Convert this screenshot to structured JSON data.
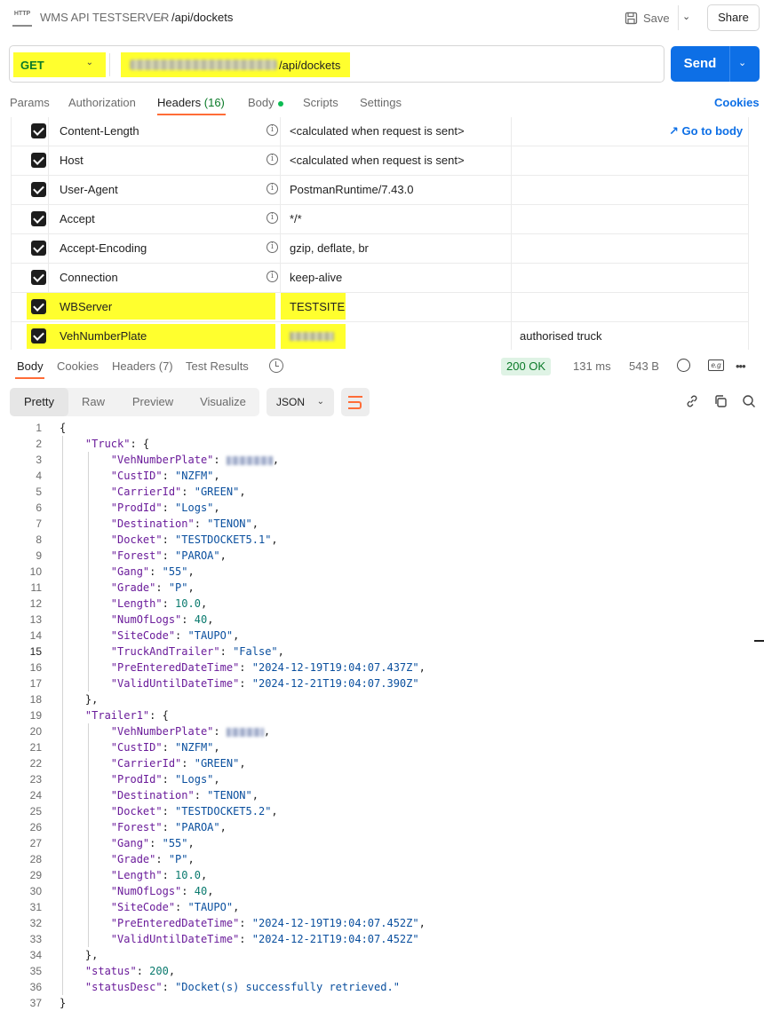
{
  "topbar": {
    "icon_label": "HTTP",
    "collection": "WMS API TESTSERVER",
    "separator": "/",
    "request_name": "/api/dockets",
    "save_label": "Save",
    "share_label": "Share"
  },
  "request": {
    "method": "GET",
    "url_path": "/api/dockets",
    "send_label": "Send"
  },
  "request_tabs": {
    "params": "Params",
    "authorization": "Authorization",
    "headers": "Headers",
    "headers_count": "(16)",
    "body": "Body",
    "scripts": "Scripts",
    "settings": "Settings",
    "cookies": "Cookies"
  },
  "headers": [
    {
      "key": "Content-Length",
      "value": "<calculated when request is sent>",
      "description": "",
      "action": "Go to body"
    },
    {
      "key": "Host",
      "value": "<calculated when request is sent>",
      "description": ""
    },
    {
      "key": "User-Agent",
      "value": "PostmanRuntime/7.43.0",
      "description": ""
    },
    {
      "key": "Accept",
      "value": "*/*",
      "description": ""
    },
    {
      "key": "Accept-Encoding",
      "value": "gzip, deflate, br",
      "description": ""
    },
    {
      "key": "Connection",
      "value": "keep-alive",
      "description": ""
    },
    {
      "key": "WBServer",
      "value": "TESTSITE",
      "description": ""
    },
    {
      "key": "VehNumberPlate",
      "value": "",
      "description": "authorised truck"
    }
  ],
  "response_tabs": {
    "body": "Body",
    "cookies": "Cookies",
    "headers": "Headers (7)",
    "test_results": "Test Results"
  },
  "response_meta": {
    "status": "200 OK",
    "time": "131 ms",
    "size": "543 B"
  },
  "view_modes": {
    "pretty": "Pretty",
    "raw": "Raw",
    "preview": "Preview",
    "visualize": "Visualize",
    "format": "JSON"
  },
  "icons": {
    "save": "save-icon",
    "history": "history-icon",
    "globe": "globe-icon",
    "copy": "copy-icon",
    "link": "link-icon",
    "search": "search-icon",
    "more": "more-icon",
    "wrap": "wrap-lines-icon"
  },
  "colors": {
    "accent": "#ff6c37",
    "send": "#0d6fe6",
    "highlight": "#ffff2e",
    "status_ok": "#0a7a28"
  },
  "code_lines": [
    {
      "n": "1",
      "t": "{"
    },
    {
      "n": "2",
      "t": "    \"Truck\": {"
    },
    {
      "n": "3",
      "t": "        \"VehNumberPlate\": ",
      "blur": true,
      "after": ","
    },
    {
      "n": "4",
      "t": "        \"CustID\": \"NZFM\","
    },
    {
      "n": "5",
      "t": "        \"CarrierId\": \"GREEN\","
    },
    {
      "n": "6",
      "t": "        \"ProdId\": \"Logs\","
    },
    {
      "n": "7",
      "t": "        \"Destination\": \"TENON\","
    },
    {
      "n": "8",
      "t": "        \"Docket\": \"TESTDOCKET5.1\","
    },
    {
      "n": "9",
      "t": "        \"Forest\": \"PAROA\","
    },
    {
      "n": "10",
      "t": "        \"Gang\": \"55\","
    },
    {
      "n": "11",
      "t": "        \"Grade\": \"P\","
    },
    {
      "n": "12",
      "t": "        \"Length\": 10.0,"
    },
    {
      "n": "13",
      "t": "        \"NumOfLogs\": 40,"
    },
    {
      "n": "14",
      "t": "        \"SiteCode\": \"TAUPO\","
    },
    {
      "n": "15",
      "t": "        \"TruckAndTrailer\": \"False\","
    },
    {
      "n": "16",
      "t": "        \"PreEnteredDateTime\": \"2024-12-19T19:04:07.437Z\","
    },
    {
      "n": "17",
      "t": "        \"ValidUntilDateTime\": \"2024-12-21T19:04:07.390Z\""
    },
    {
      "n": "18",
      "t": "    },"
    },
    {
      "n": "19",
      "t": "    \"Trailer1\": {"
    },
    {
      "n": "20",
      "t": "        \"VehNumberPlate\": ",
      "blur": true,
      "short": true,
      "after": ","
    },
    {
      "n": "21",
      "t": "        \"CustID\": \"NZFM\","
    },
    {
      "n": "22",
      "t": "        \"CarrierId\": \"GREEN\","
    },
    {
      "n": "23",
      "t": "        \"ProdId\": \"Logs\","
    },
    {
      "n": "24",
      "t": "        \"Destination\": \"TENON\","
    },
    {
      "n": "25",
      "t": "        \"Docket\": \"TESTDOCKET5.2\","
    },
    {
      "n": "26",
      "t": "        \"Forest\": \"PAROA\","
    },
    {
      "n": "27",
      "t": "        \"Gang\": \"55\","
    },
    {
      "n": "28",
      "t": "        \"Grade\": \"P\","
    },
    {
      "n": "29",
      "t": "        \"Length\": 10.0,"
    },
    {
      "n": "30",
      "t": "        \"NumOfLogs\": 40,"
    },
    {
      "n": "31",
      "t": "        \"SiteCode\": \"TAUPO\","
    },
    {
      "n": "32",
      "t": "        \"PreEnteredDateTime\": \"2024-12-19T19:04:07.452Z\","
    },
    {
      "n": "33",
      "t": "        \"ValidUntilDateTime\": \"2024-12-21T19:04:07.452Z\""
    },
    {
      "n": "34",
      "t": "    },"
    },
    {
      "n": "35",
      "t": "    \"status\": 200,"
    },
    {
      "n": "36",
      "t": "    \"statusDesc\": \"Docket(s) successfully retrieved.\""
    },
    {
      "n": "37",
      "t": "}"
    }
  ]
}
